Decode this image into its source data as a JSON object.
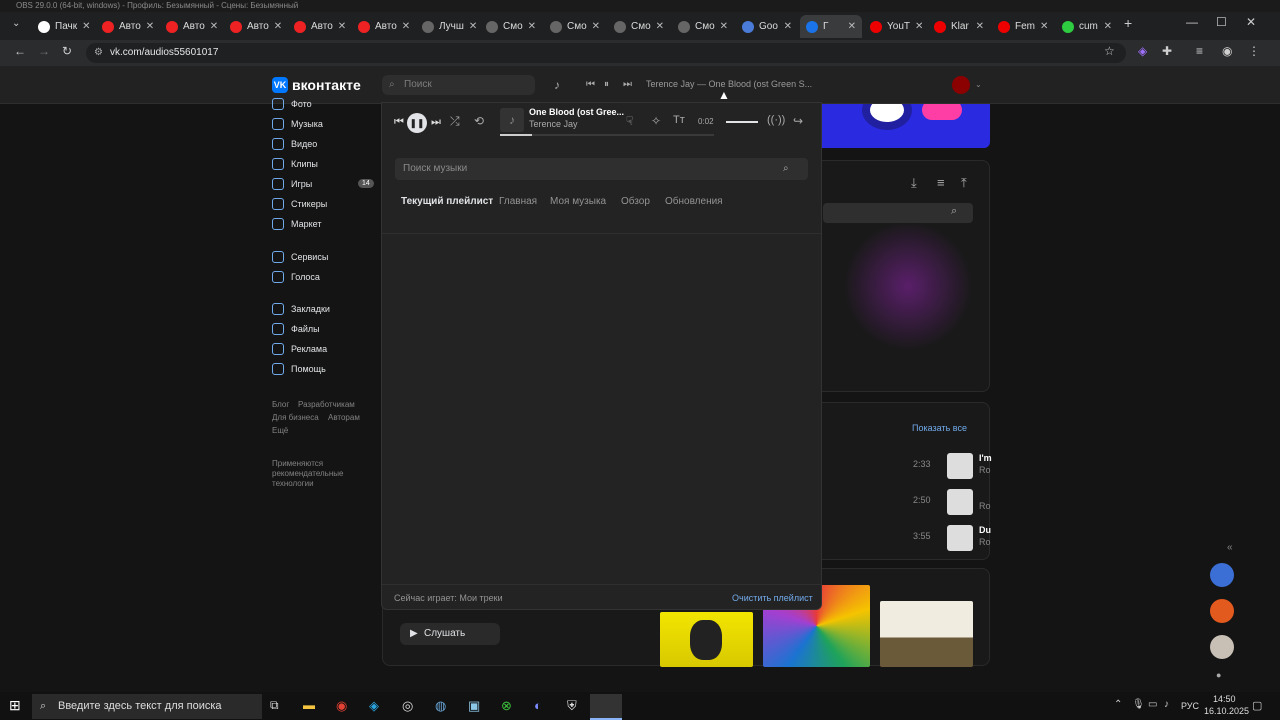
{
  "obs": {
    "title": "OBS 29.0.0 (64-bit, windows) - Профиль: Безымянный - Сцены: Безымянный"
  },
  "browser": {
    "tabs": [
      {
        "label": "Пачк",
        "color": "#ffffff"
      },
      {
        "label": "Авто",
        "color": "#e22"
      },
      {
        "label": "Авто",
        "color": "#e22"
      },
      {
        "label": "Авто",
        "color": "#e22"
      },
      {
        "label": "Авто",
        "color": "#e22"
      },
      {
        "label": "Авто",
        "color": "#e22"
      },
      {
        "label": "Лучш",
        "color": "#666"
      },
      {
        "label": "Смо",
        "color": "#666"
      },
      {
        "label": "Смо",
        "color": "#666"
      },
      {
        "label": "Смо",
        "color": "#666"
      },
      {
        "label": "Смо",
        "color": "#666"
      },
      {
        "label": "Goo",
        "color": "#4a7bd8"
      },
      {
        "label": "Г",
        "color": "#1a73e8"
      },
      {
        "label": "YouT",
        "color": "#e00"
      },
      {
        "label": "Klar",
        "color": "#e00"
      },
      {
        "label": "Fem",
        "color": "#e00"
      },
      {
        "label": "cum",
        "color": "#2ecc40"
      }
    ],
    "url": "vk.com/audios55601017"
  },
  "vk": {
    "logo_text": "вконтакте",
    "search_placeholder": "Поиск",
    "top_nowplaying": "Terence Jay — One Blood (ost Green S...",
    "sidebar": [
      {
        "label": "Фото"
      },
      {
        "label": "Музыка"
      },
      {
        "label": "Видео"
      },
      {
        "label": "Клипы"
      },
      {
        "label": "Игры",
        "badge": "14"
      },
      {
        "label": "Стикеры"
      },
      {
        "label": "Маркет"
      },
      {
        "label": "Сервисы"
      },
      {
        "label": "Голоса"
      },
      {
        "label": "Закладки"
      },
      {
        "label": "Файлы"
      },
      {
        "label": "Реклама"
      },
      {
        "label": "Помощь"
      }
    ],
    "footer_links": [
      "Блог",
      "Разработчикам",
      "Для бизнеса",
      "Авторам",
      "Ещё"
    ],
    "recommend_note": "Применяются рекомендательные технологии",
    "show_all": "Показать все",
    "listen": "Слушать",
    "tracks_right": [
      {
        "time": "2:33",
        "title": "I'm",
        "sub": "Ro"
      },
      {
        "time": "2:50",
        "title": "",
        "sub": "Ro"
      },
      {
        "time": "3:55",
        "title": "Du",
        "sub": "Ro"
      }
    ]
  },
  "player": {
    "title": "One Blood (ost Gree...",
    "artist": "Terence Jay",
    "time": "0:02",
    "search_placeholder": "Поиск музыки",
    "tabs": [
      "Текущий плейлист",
      "Главная",
      "Моя музыка",
      "Обзор",
      "Обновления"
    ],
    "now_playing": "Сейчас играет: Мои треки",
    "clear": "Очистить плейлист"
  },
  "taskbar": {
    "search_placeholder": "Введите здесь текст для поиска",
    "lang": "РУС",
    "time": "14:50",
    "date": "16.10.2025"
  }
}
